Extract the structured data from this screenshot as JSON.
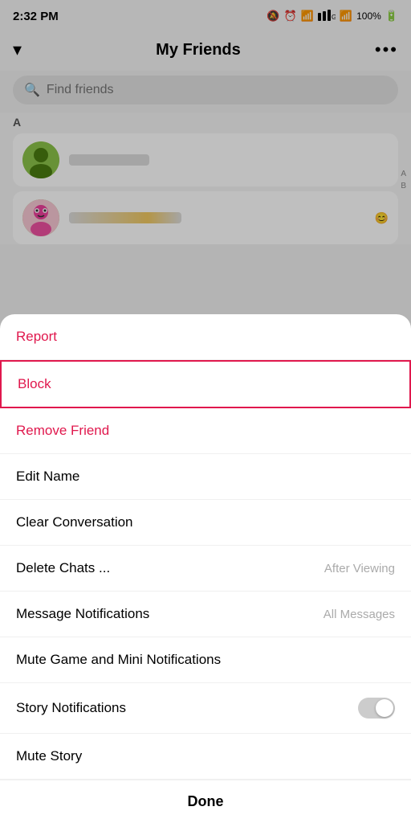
{
  "statusBar": {
    "time": "2:32 PM",
    "battery": "100%"
  },
  "header": {
    "title": "My Friends",
    "chevronIcon": "▾",
    "moreIcon": "•••"
  },
  "search": {
    "placeholder": "Find friends"
  },
  "friendsList": {
    "sectionLabel": "A",
    "alphabetIndex": [
      "A",
      "B"
    ]
  },
  "menu": {
    "report": "Report",
    "block": "Block",
    "removeFriend": "Remove Friend",
    "editName": "Edit Name",
    "clearConversation": "Clear Conversation",
    "deleteChats": "Delete Chats ...",
    "deleteChatsValue": "After Viewing",
    "messageNotifications": "Message Notifications",
    "messageNotificationsValue": "All Messages",
    "muteGameNotifications": "Mute Game and Mini Notifications",
    "storyNotifications": "Story Notifications",
    "muteStory": "Mute Story",
    "done": "Done"
  }
}
